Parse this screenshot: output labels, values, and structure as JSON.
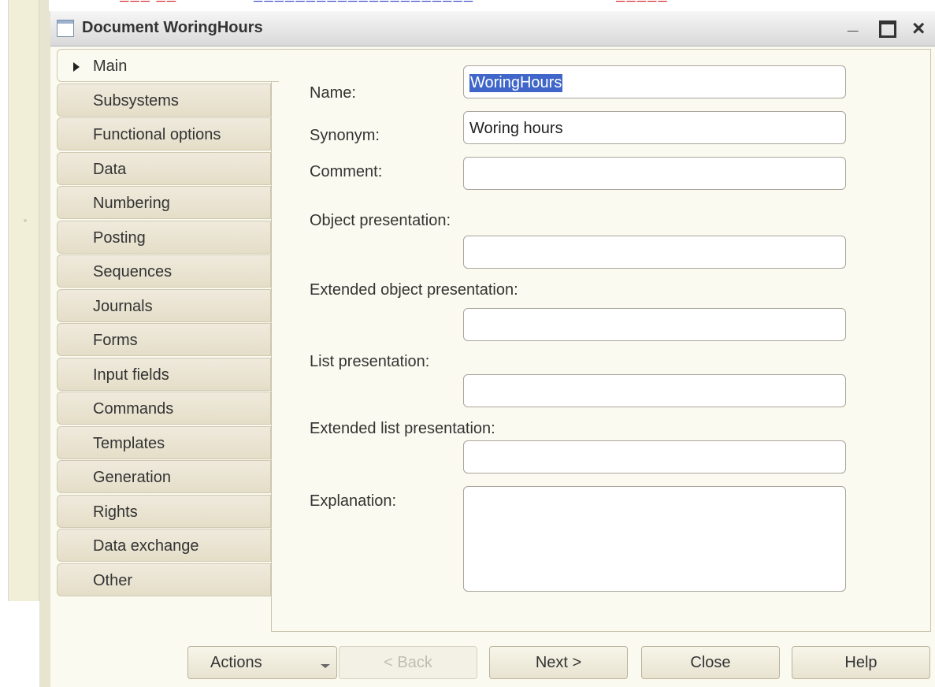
{
  "window": {
    "title": "Document WoringHours",
    "controls": {
      "minimize": "_",
      "close": "×"
    }
  },
  "tabs": [
    {
      "label": "Main",
      "active": true
    },
    {
      "label": "Subsystems"
    },
    {
      "label": "Functional options"
    },
    {
      "label": "Data"
    },
    {
      "label": "Numbering"
    },
    {
      "label": "Posting"
    },
    {
      "label": "Sequences"
    },
    {
      "label": "Journals"
    },
    {
      "label": "Forms"
    },
    {
      "label": "Input fields"
    },
    {
      "label": "Commands"
    },
    {
      "label": "Templates"
    },
    {
      "label": "Generation"
    },
    {
      "label": "Rights"
    },
    {
      "label": "Data exchange"
    },
    {
      "label": "Other"
    }
  ],
  "form": {
    "name_label": "Name:",
    "name_value": "WoringHours",
    "synonym_label": "Synonym:",
    "synonym_value": "Woring hours",
    "comment_label": "Comment:",
    "comment_value": "",
    "object_presentation_label": "Object presentation:",
    "object_presentation_value": "",
    "extended_object_presentation_label": "Extended object presentation:",
    "extended_object_presentation_value": "",
    "list_presentation_label": "List presentation:",
    "list_presentation_value": "",
    "extended_list_presentation_label": "Extended list presentation:",
    "extended_list_presentation_value": "",
    "explanation_label": "Explanation:",
    "explanation_value": ""
  },
  "buttons": {
    "actions": "Actions",
    "back": "< Back",
    "next": "Next >",
    "close": "Close",
    "help": "Help"
  },
  "colors": {
    "selection": "#3f66c8",
    "panel_background": "#fbfaf0",
    "tab_background": "#e9e4d0"
  }
}
